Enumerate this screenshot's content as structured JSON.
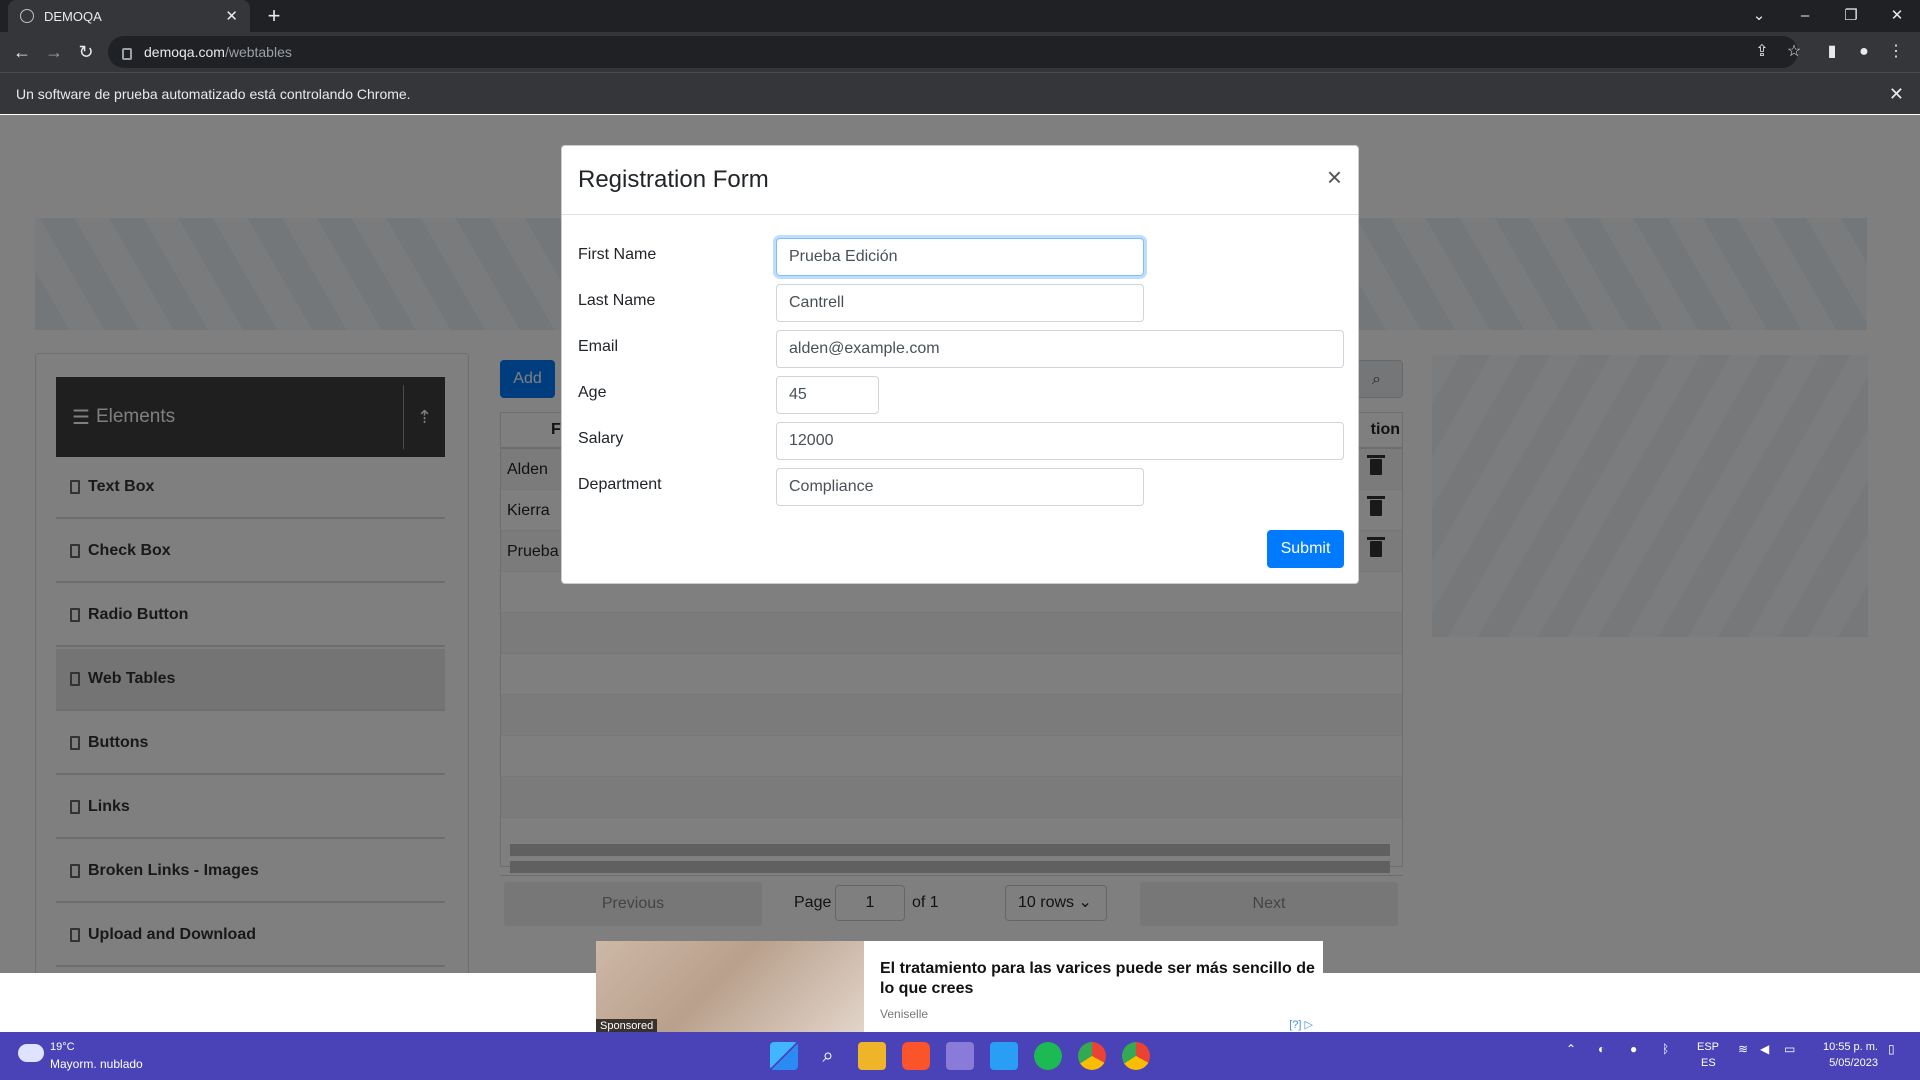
{
  "browser": {
    "tab_title": "DEMOQA",
    "url_domain": "demoqa.com",
    "url_path": "/webtables",
    "infobar_text": "Un software de prueba automatizado está controlando Chrome."
  },
  "page": {
    "sidebar": {
      "header": "Elements",
      "items": [
        {
          "label": "Text Box"
        },
        {
          "label": "Check Box"
        },
        {
          "label": "Radio Button"
        },
        {
          "label": "Web Tables"
        },
        {
          "label": "Buttons"
        },
        {
          "label": "Links"
        },
        {
          "label": "Broken Links - Images"
        },
        {
          "label": "Upload and Download"
        }
      ],
      "active": "Web Tables"
    },
    "add_label": "Add",
    "table": {
      "header_left": "Fi",
      "header_right": "tion",
      "rows": [
        "Alden",
        "Kierra",
        "Prueba"
      ]
    },
    "pagination": {
      "previous": "Previous",
      "page_label": "Page",
      "page_value": "1",
      "of_label": "of 1",
      "rows_select": "10 rows",
      "next": "Next"
    }
  },
  "modal": {
    "title": "Registration Form",
    "close": "×",
    "fields": {
      "first_name": {
        "label": "First Name",
        "value": "Prueba Edición"
      },
      "last_name": {
        "label": "Last Name",
        "value": "Cantrell"
      },
      "email": {
        "label": "Email",
        "value": "alden@example.com"
      },
      "age": {
        "label": "Age",
        "value": "45"
      },
      "salary": {
        "label": "Salary",
        "value": "12000"
      },
      "department": {
        "label": "Department",
        "value": "Compliance"
      }
    },
    "submit": "Submit"
  },
  "ad": {
    "sponsored": "Sponsored",
    "title": "El tratamiento para las varices puede ser más sencillo de lo que crees",
    "source": "Veniselle",
    "info": "[?]"
  },
  "taskbar": {
    "weather_temp": "19°C",
    "weather_desc": "Mayorm. nublado",
    "lang_top": "ESP",
    "lang_bottom": "ES",
    "time": "10:55 p. m.",
    "date": "5/05/2023"
  },
  "colors": {
    "primary": "#007bff",
    "taskbar": "#4a43b8",
    "chrome_dark": "#202124"
  }
}
